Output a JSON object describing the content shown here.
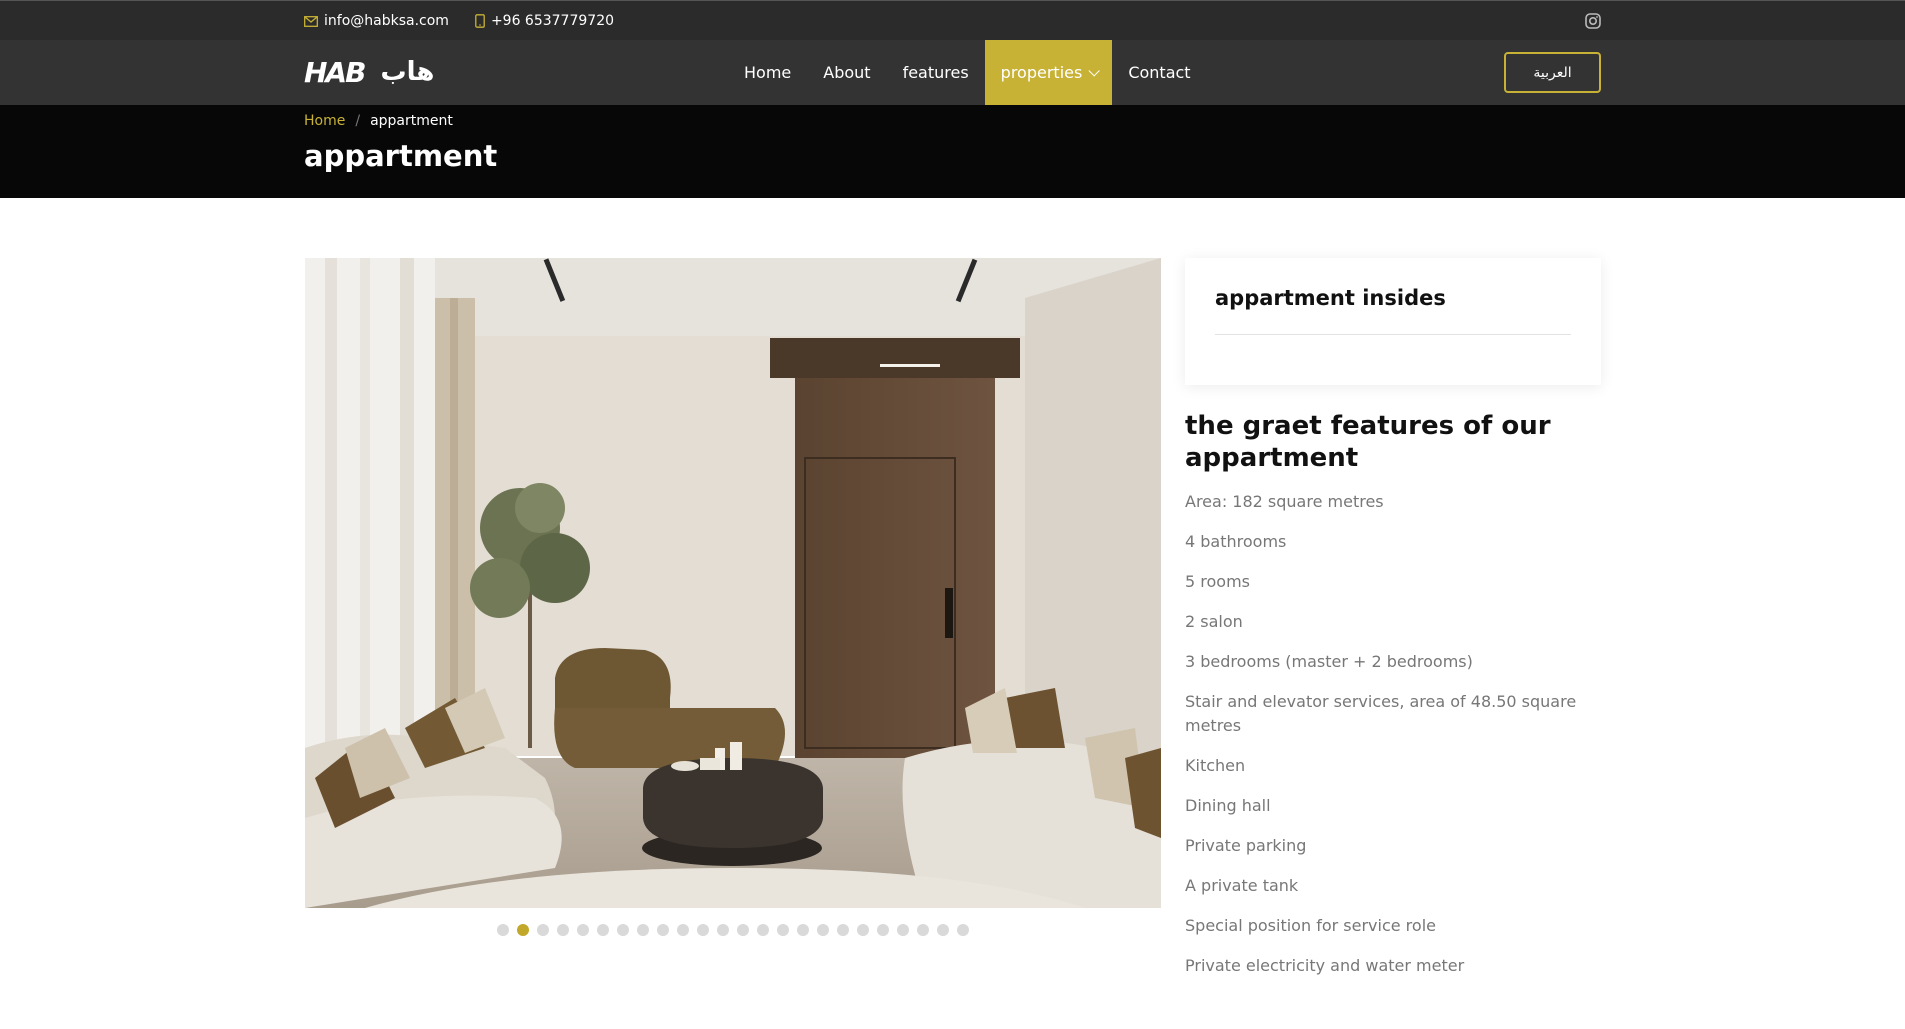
{
  "topbar": {
    "email": "info@habksa.com",
    "phone": "+96 6537779720"
  },
  "nav": {
    "logo_latin": "HAB",
    "logo_arabic": "هاب",
    "items": [
      {
        "label": "Home"
      },
      {
        "label": "About"
      },
      {
        "label": "features"
      },
      {
        "label": "properties",
        "active": true
      },
      {
        "label": "Contact"
      }
    ],
    "lang_button": "العربية"
  },
  "header": {
    "breadcrumb_home": "Home",
    "breadcrumb_sep": "/",
    "breadcrumb_current": "appartment",
    "title": "appartment"
  },
  "gallery": {
    "dot_count": 24,
    "active_dot": 1
  },
  "sidebar": {
    "card_title": "appartment insides"
  },
  "features": {
    "title": "the graet features of our appartment",
    "items": [
      "Area: 182 square metres",
      "4 bathrooms",
      "5 rooms",
      "2 salon",
      "3 bedrooms (master + 2 bedrooms)",
      "Stair and elevator services, area of 48.50 square metres",
      "Kitchen",
      "Dining hall",
      "Private parking",
      "A private tank",
      "Special position for service role",
      "Private electricity and water meter"
    ]
  },
  "colors": {
    "accent": "#c8b236",
    "topbar": "#2b2b2b",
    "navbar": "#333333",
    "pagehead": "#070707"
  }
}
